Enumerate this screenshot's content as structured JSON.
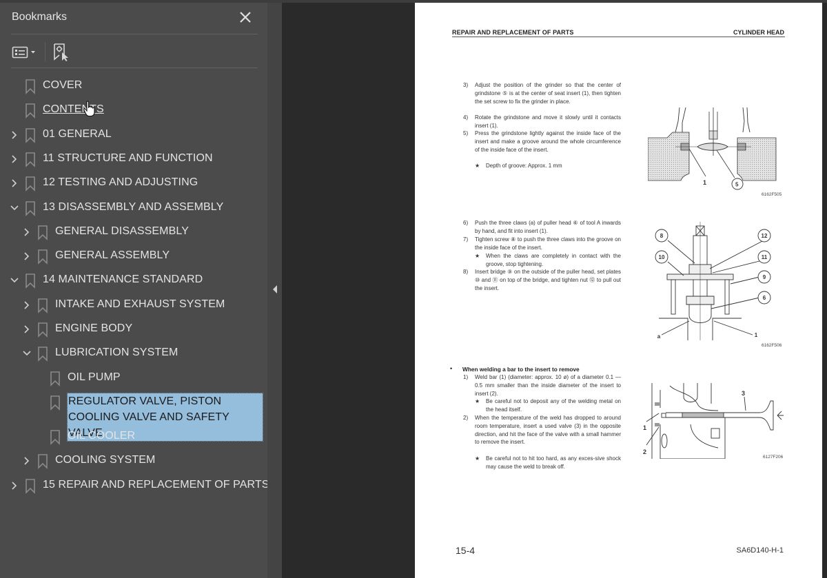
{
  "sidebar": {
    "title": "Bookmarks",
    "close_icon": "close-icon",
    "options_icon": "list-options-icon",
    "find_bookmark_icon": "find-current-bookmark-icon",
    "items": [
      {
        "label": "COVER",
        "level": 0,
        "expander": "none"
      },
      {
        "label": "CONTENTS",
        "level": 0,
        "expander": "none",
        "hovered": true
      },
      {
        "label": "01 GENERAL",
        "level": 0,
        "expander": "collapsed"
      },
      {
        "label": "11 STRUCTURE AND FUNCTION",
        "level": 0,
        "expander": "collapsed"
      },
      {
        "label": "12 TESTING AND ADJUSTING",
        "level": 0,
        "expander": "collapsed"
      },
      {
        "label": "13 DISASSEMBLY AND ASSEMBLY",
        "level": 0,
        "expander": "expanded"
      },
      {
        "label": "GENERAL DISASSEMBLY",
        "level": 1,
        "expander": "collapsed"
      },
      {
        "label": "GENERAL ASSEMBLY",
        "level": 1,
        "expander": "collapsed"
      },
      {
        "label": "14 MAINTENANCE STANDARD",
        "level": 0,
        "expander": "expanded"
      },
      {
        "label": "INTAKE AND EXHAUST SYSTEM",
        "level": 1,
        "expander": "collapsed"
      },
      {
        "label": "ENGINE BODY",
        "level": 1,
        "expander": "collapsed"
      },
      {
        "label": "LUBRICATION SYSTEM",
        "level": 1,
        "expander": "expanded"
      },
      {
        "label": "OIL PUMP",
        "level": 2,
        "expander": "none"
      },
      {
        "label": "REGULATOR VALVE, PISTON COOLING VALVE AND SAFETY VALVE",
        "level": 2,
        "expander": "none",
        "selected": true
      },
      {
        "label": "OIL COOLER",
        "level": 2,
        "expander": "none"
      },
      {
        "label": "COOLING SYSTEM",
        "level": 1,
        "expander": "collapsed"
      },
      {
        "label": "15 REPAIR AND REPLACEMENT OF PARTS",
        "level": 0,
        "expander": "collapsed"
      }
    ]
  },
  "colors": {
    "sidebar_bg": "#4b4b4b",
    "viewer_bg": "#2a2a2a",
    "selection": "#95bddc"
  },
  "page": {
    "header_left": "REPAIR AND REPLACEMENT OF PARTS",
    "header_right": "CYLINDER HEAD",
    "steps_a": [
      {
        "num": "3)",
        "text": "Adjust the position of the grinder so that the center of grindstone ⑤ is at the center of seat insert (1), then tighten the set screw to fix the grinder in place."
      },
      {
        "num": "4)",
        "text": "Rotate the grindstone and move it slowly until it contacts insert (1)."
      },
      {
        "num": "5)",
        "text": "Press the grindstone lightly against the inside face of the insert and make a groove around the whole circumference of the inside face of the insert."
      }
    ],
    "note_a": "Depth of groove: Approx. 1 mm",
    "steps_b": [
      {
        "num": "6)",
        "text": "Push the three claws (a) of puller head ⑥ of tool A inwards by hand, and fit into insert (1)."
      },
      {
        "num": "7)",
        "text": "Tighten screw ⑧ to push the three claws into the groove on the inside face of the insert."
      },
      {
        "num": "8)",
        "text": "Insert bridge ⑨ on the outside of the puller head, set plates ⑩ and ⑪ on top of the bridge, and tighten nut ⑫ to pull out the insert."
      }
    ],
    "note_b": "When the claws are completely in contact with the groove, stop tightening.",
    "bullet_title": "When welding a bar to the insert to remove",
    "steps_c": [
      {
        "num": "1)",
        "text": "Weld bar (1) (diameter: approx. 10 ø) of a diameter 0.1 — 0.5 mm smaller than the inside diameter of the insert to insert (2)."
      },
      {
        "num": "2)",
        "text": "When the temperature of the weld has dropped to around room temperature, insert a used valve (3) in the opposite direction, and hit the face of the valve with a small hammer to remove the insert."
      }
    ],
    "note_c1": "Be careful not to deposit any of the welding metal on the head itself.",
    "note_c2": "Be careful not to hit too hard, as any exces-sive shock may cause the weld to break off.",
    "star": "★",
    "bullet": "•",
    "fig1": {
      "code": "6162F505",
      "labels": [
        "1",
        "5"
      ]
    },
    "fig2": {
      "code": "6162F506",
      "labels": [
        "8",
        "12",
        "10",
        "11",
        "9",
        "6",
        "a",
        "1"
      ]
    },
    "fig3": {
      "code": "6127F206",
      "labels": [
        "3",
        "1",
        "2"
      ]
    },
    "page_number": "15-4",
    "doc_code": "SA6D140-H-1"
  }
}
